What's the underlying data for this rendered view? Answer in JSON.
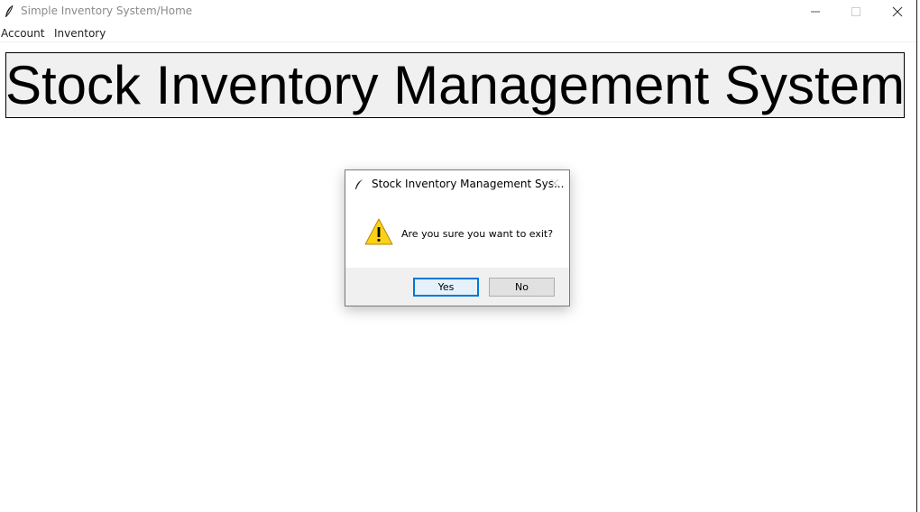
{
  "window": {
    "title": "Simple Inventory System/Home",
    "icon": "feather-icon",
    "controls": [
      "minimize-icon",
      "maximize-icon",
      "close-icon"
    ]
  },
  "menu": {
    "items": [
      {
        "label": "Account"
      },
      {
        "label": "Inventory"
      }
    ]
  },
  "header": {
    "title": "Stock Inventory Management System"
  },
  "dialog": {
    "title": "Stock Inventory Management Sys...",
    "icon": "warning-icon",
    "message": "Are you sure you want to exit?",
    "yes_label": "Yes",
    "no_label": "No",
    "accent_color": "#0078d7",
    "warning_color": "#fcd116"
  }
}
